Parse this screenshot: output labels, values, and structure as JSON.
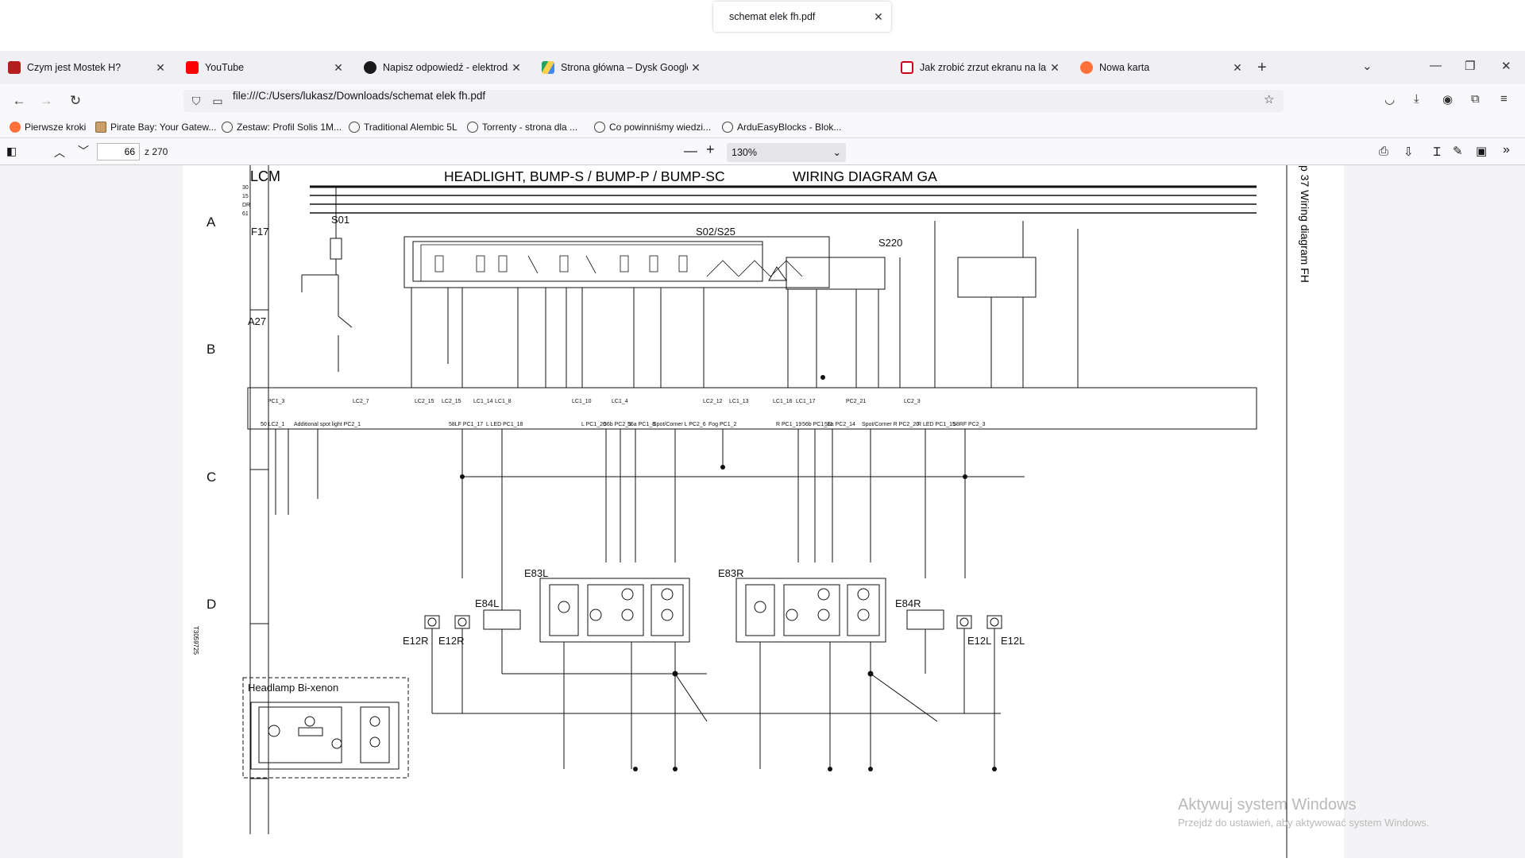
{
  "tabs": [
    {
      "title": "Czym jest Mostek H?",
      "fav": "#b41e1e"
    },
    {
      "title": "YouTube",
      "fav": "#ff0000"
    },
    {
      "title": "Napisz odpowiedź - elektroda.pl",
      "fav": "#1a1a1a"
    },
    {
      "title": "Strona główna – Dysk Google",
      "fav": "#1fa463"
    },
    {
      "title": "schemat elek fh.pdf",
      "fav": ""
    },
    {
      "title": "Jak zrobić zrzut ekranu na lapto",
      "fav": "#d0021b"
    },
    {
      "title": "Nowa karta",
      "fav": "#ff7139"
    }
  ],
  "url": "file:///C:/Users/lukasz/Downloads/schemat elek fh.pdf",
  "bookmarks": [
    "Pierwsze kroki",
    "Pirate Bay: Your Gatew...",
    "Zestaw: Profil Solis 1M...",
    "Traditional Alembic 5L",
    "Torrenty - strona dla ...",
    "Co powinniśmy wiedzi...",
    "ArduEasyBlocks - Blok..."
  ],
  "pdf": {
    "page_number": "66",
    "page_total": "z 270",
    "zoom": "130%"
  },
  "diagram": {
    "header_left": "LCM",
    "header_title": "HEADLIGHT, BUMP-S / BUMP-P / BUMP-SC",
    "header_right": "WIRING DIAGRAM GA",
    "side_title": "p 37 Wiring diagram FH",
    "rows": [
      "A",
      "B",
      "C",
      "D"
    ],
    "bus_labels": [
      "30",
      "15",
      "DR",
      "61"
    ],
    "labels": {
      "f17": "F17",
      "s01": "S01",
      "s02": "S02/S25",
      "s220": "S220",
      "a27": "A27",
      "e83l": "E83L",
      "e83r": "E83R",
      "e84l": "E84L",
      "e84r": "E84R",
      "e12r_a": "E12R",
      "e12r_b": "E12R",
      "e12l_a": "E12L",
      "e12l_b": "E12L",
      "bixenon": "Headlamp Bi-xenon",
      "doc_id": "T3059725"
    },
    "a27_pins": [
      "PC1_3",
      "LC2_7",
      "LC2_15",
      "LC2_15",
      "LC1_14",
      "LC1_8",
      "LC1_10",
      "LC1_4",
      "LC2_12",
      "LC1_13",
      "LC1_16",
      "LC1_17",
      "PC2_21",
      "LC2_3"
    ],
    "a27_inner": [
      "50 LC2_1",
      "Additional spot light PC2_1",
      "58LF PC1_17",
      "L LED PC1_18",
      "L PC1_20",
      "56b PC2_5",
      "56a PC1_8",
      "Spot/Corner L PC2_6",
      "Fog PC1_2",
      "R PC1_19",
      "56b PC1_11",
      "56a PC2_14",
      "Spot/Corner R PC2_20",
      "R LED PC1_15",
      "58RF PC2_3"
    ]
  },
  "watermark": {
    "line1": "Aktywuj system Windows",
    "line2": "Przejdź do ustawień, aby aktywować system Windows."
  }
}
